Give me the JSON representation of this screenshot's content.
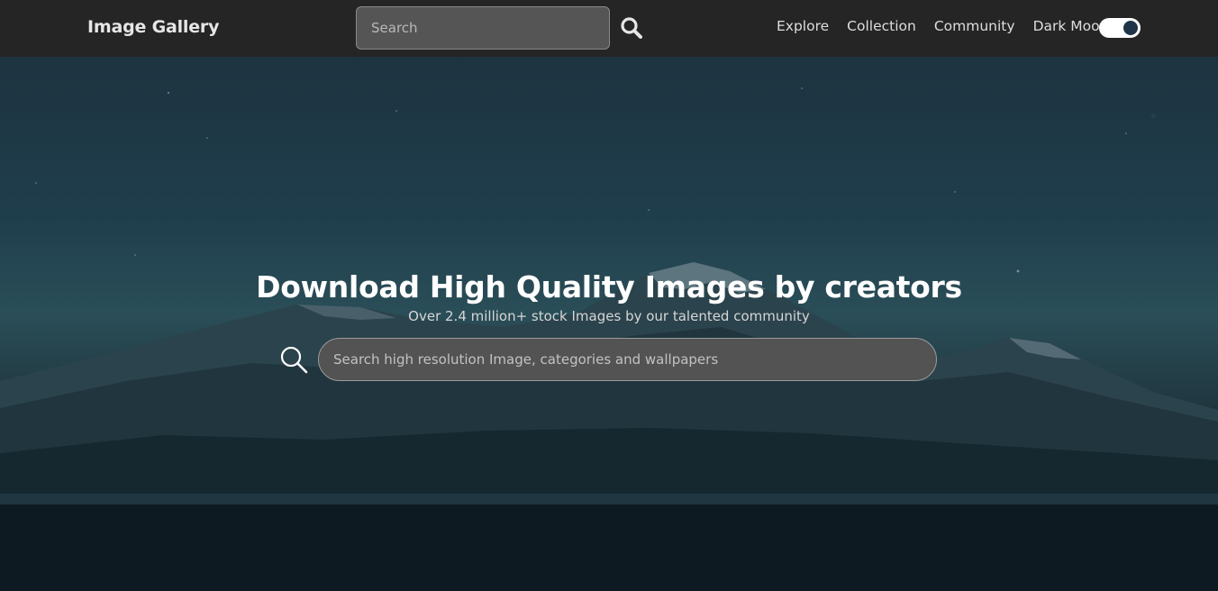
{
  "navbar": {
    "brand": "Image Gallery",
    "search_placeholder": "Search",
    "links": [
      "Explore",
      "Collection",
      "Community"
    ],
    "dark_mode_label": "Dark Mood",
    "dark_mode_on": true
  },
  "hero": {
    "title": "Download High Quality Images by creators",
    "subtitle": "Over 2.4 million+ stock Images by our talented community",
    "search_placeholder": "Search high resolution Image, categories and wallpapers"
  },
  "icons": {
    "nav_search": "search-icon",
    "hero_search": "search-icon"
  }
}
